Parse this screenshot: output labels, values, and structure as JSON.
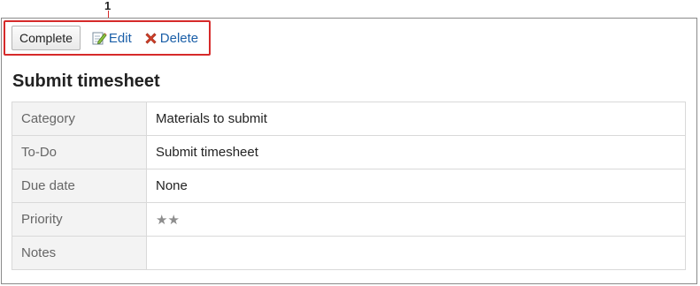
{
  "callout": {
    "number": "1"
  },
  "toolbar": {
    "complete_label": "Complete",
    "edit_label": "Edit",
    "delete_label": "Delete"
  },
  "todo": {
    "title": "Submit timesheet",
    "rows": [
      {
        "label": "Category",
        "value": "Materials to submit"
      },
      {
        "label": "To-Do",
        "value": "Submit timesheet"
      },
      {
        "label": "Due date",
        "value": "None"
      },
      {
        "label": "Priority",
        "value": "★★",
        "level": 2
      },
      {
        "label": "Notes",
        "value": ""
      }
    ]
  },
  "colors": {
    "link": "#1b5fa8",
    "highlight": "#d62a2a",
    "label_bg": "#f3f3f3"
  },
  "icons": {
    "edit": "pencil-edit-icon",
    "delete": "red-x-delete-icon"
  }
}
